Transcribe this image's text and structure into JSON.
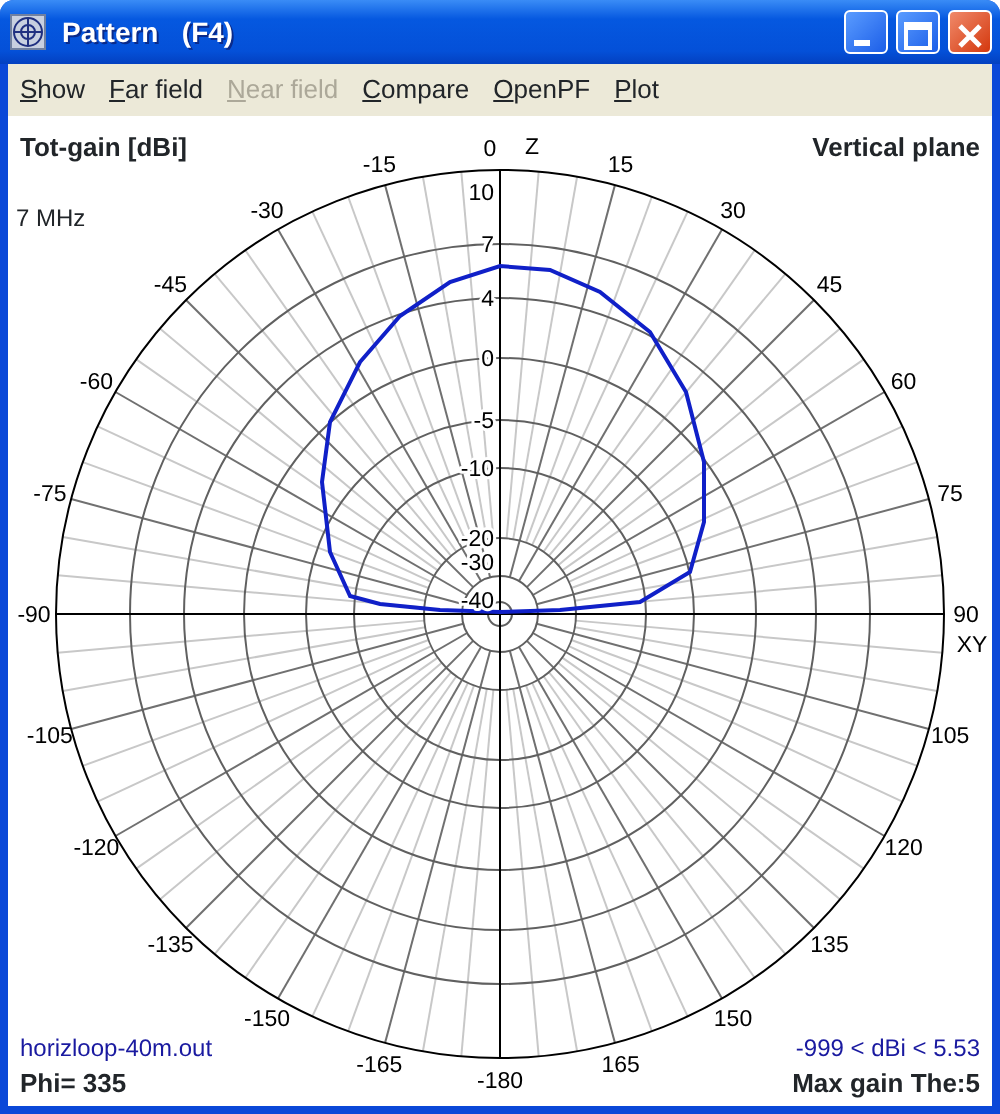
{
  "window": {
    "title": "Pattern   (F4)"
  },
  "menu": [
    {
      "label": "Show",
      "disabled": false
    },
    {
      "label": "Far field",
      "disabled": false
    },
    {
      "label": "Near field",
      "disabled": true
    },
    {
      "label": "Compare",
      "disabled": false
    },
    {
      "label": "OpenPF",
      "disabled": false
    },
    {
      "label": "Plot",
      "disabled": false
    }
  ],
  "plot": {
    "quantity": "Tot-gain [dBi]",
    "frequency": "7 MHz",
    "plane": "Vertical plane",
    "zenith_label": "Z",
    "horizon_label": "XY",
    "angle_labels": [
      "0",
      "-15",
      "15",
      "-30",
      "30",
      "-45",
      "45",
      "-60",
      "60",
      "-75",
      "75",
      "-90",
      "90",
      "-105",
      "105",
      "-120",
      "120",
      "-135",
      "135",
      "-150",
      "150",
      "-165",
      "165",
      "-180"
    ],
    "ring_labels": [
      "10",
      "7",
      "4",
      "0",
      "-5",
      "-10",
      "-20",
      "-30",
      "-40"
    ],
    "file": "horizloop-40m.out",
    "phi": "Phi= 335",
    "range": "-999 < dBi < 5.53",
    "max_gain": "Max gain The:5"
  }
}
